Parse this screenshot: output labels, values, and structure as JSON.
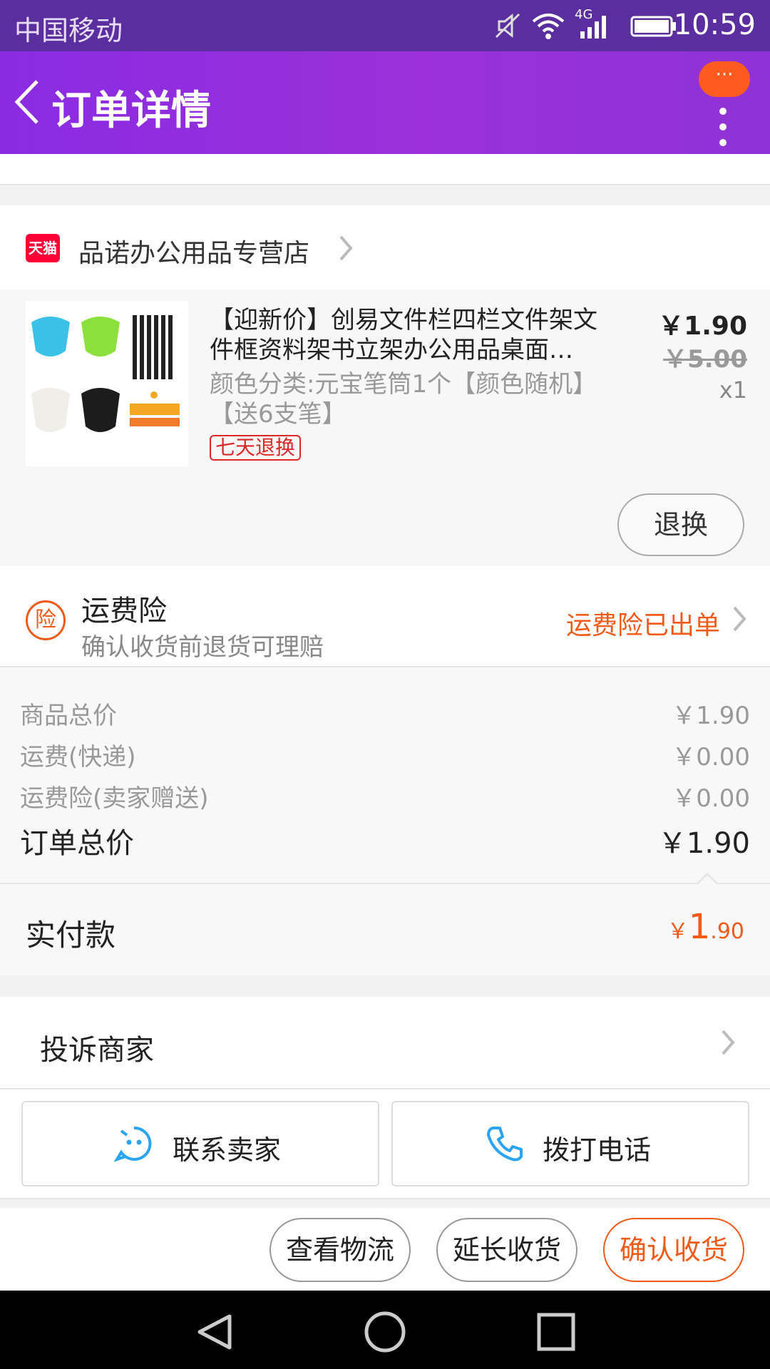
{
  "status_bar": {
    "carrier": "中国移动",
    "network": "4G",
    "time": "10:59"
  },
  "header": {
    "title": "订单详情",
    "badge": "···"
  },
  "shop": {
    "tag": "天猫",
    "name": "品诺办公用品专营店"
  },
  "product": {
    "title": "【迎新价】创易文件栏四栏文件架文件框资料架书立架办公用品桌面…",
    "sku": "颜色分类:元宝笔筒1个【颜色随机】【送6支笔】",
    "tag": "七天退换",
    "price": "￥1.90",
    "original_price": "￥5.00",
    "quantity": "x1",
    "return_button": "退换"
  },
  "insurance": {
    "icon_char": "险",
    "title": "运费险",
    "subtitle": "确认收货前退货可理赔",
    "status": "运费险已出单"
  },
  "summary": {
    "rows": [
      {
        "label": "商品总价",
        "value": "￥1.90"
      },
      {
        "label": "运费(快递)",
        "value": "￥0.00"
      },
      {
        "label": "运费险(卖家赠送)",
        "value": "￥0.00"
      }
    ],
    "total_label": "订单总价",
    "total_value": "￥1.90"
  },
  "paid": {
    "label": "实付款",
    "currency": "￥",
    "integer": "1",
    "decimal": ".90"
  },
  "complain": {
    "label": "投诉商家"
  },
  "contact": {
    "seller": "联系卖家",
    "phone": "拨打电话"
  },
  "actions": {
    "logistics": "查看物流",
    "extend": "延长收货",
    "confirm": "确认收货"
  },
  "colors": {
    "header_purple": "#8a2be2",
    "accent_orange": "#f25a1a",
    "tmall_red": "#ff0036",
    "contact_blue": "#2aa4f4"
  }
}
